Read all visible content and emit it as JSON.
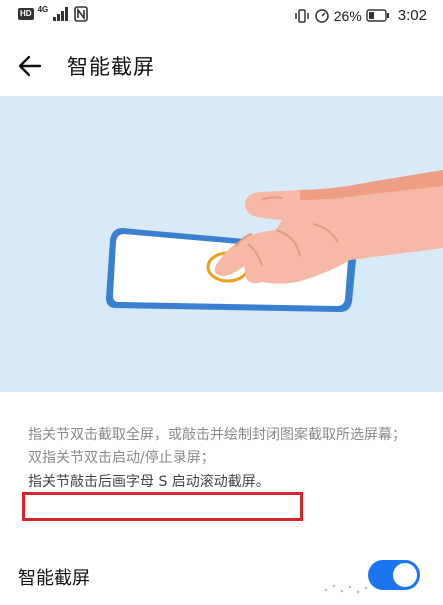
{
  "status_bar": {
    "left_badge": "HD",
    "network_label": "4G",
    "battery_percent": "26%",
    "time": "3:02",
    "icons": [
      "hd-icon",
      "signal-icon",
      "nfc-icon",
      "vibrate-icon",
      "data-saver-icon",
      "battery-icon"
    ]
  },
  "app_bar": {
    "back_icon": "arrow-left-icon",
    "title": "智能截屏"
  },
  "illustration": {
    "description_icon": "knuckle-screenshot-illustration"
  },
  "description": {
    "line1": "指关节双击截取全屏，或敲击并绘制封闭图案截取所选屏幕；",
    "line2": "双指关节双击启动/停止录屏；",
    "line3": "指关节敲击后画字母 S 启动滚动截屏。"
  },
  "setting": {
    "label": "智能截屏",
    "enabled": true
  },
  "colors": {
    "accent": "#1976f0",
    "illustration_bg": "#d8e9f7",
    "highlight_border": "#d6232c",
    "description_text": "#8a8a8a"
  }
}
